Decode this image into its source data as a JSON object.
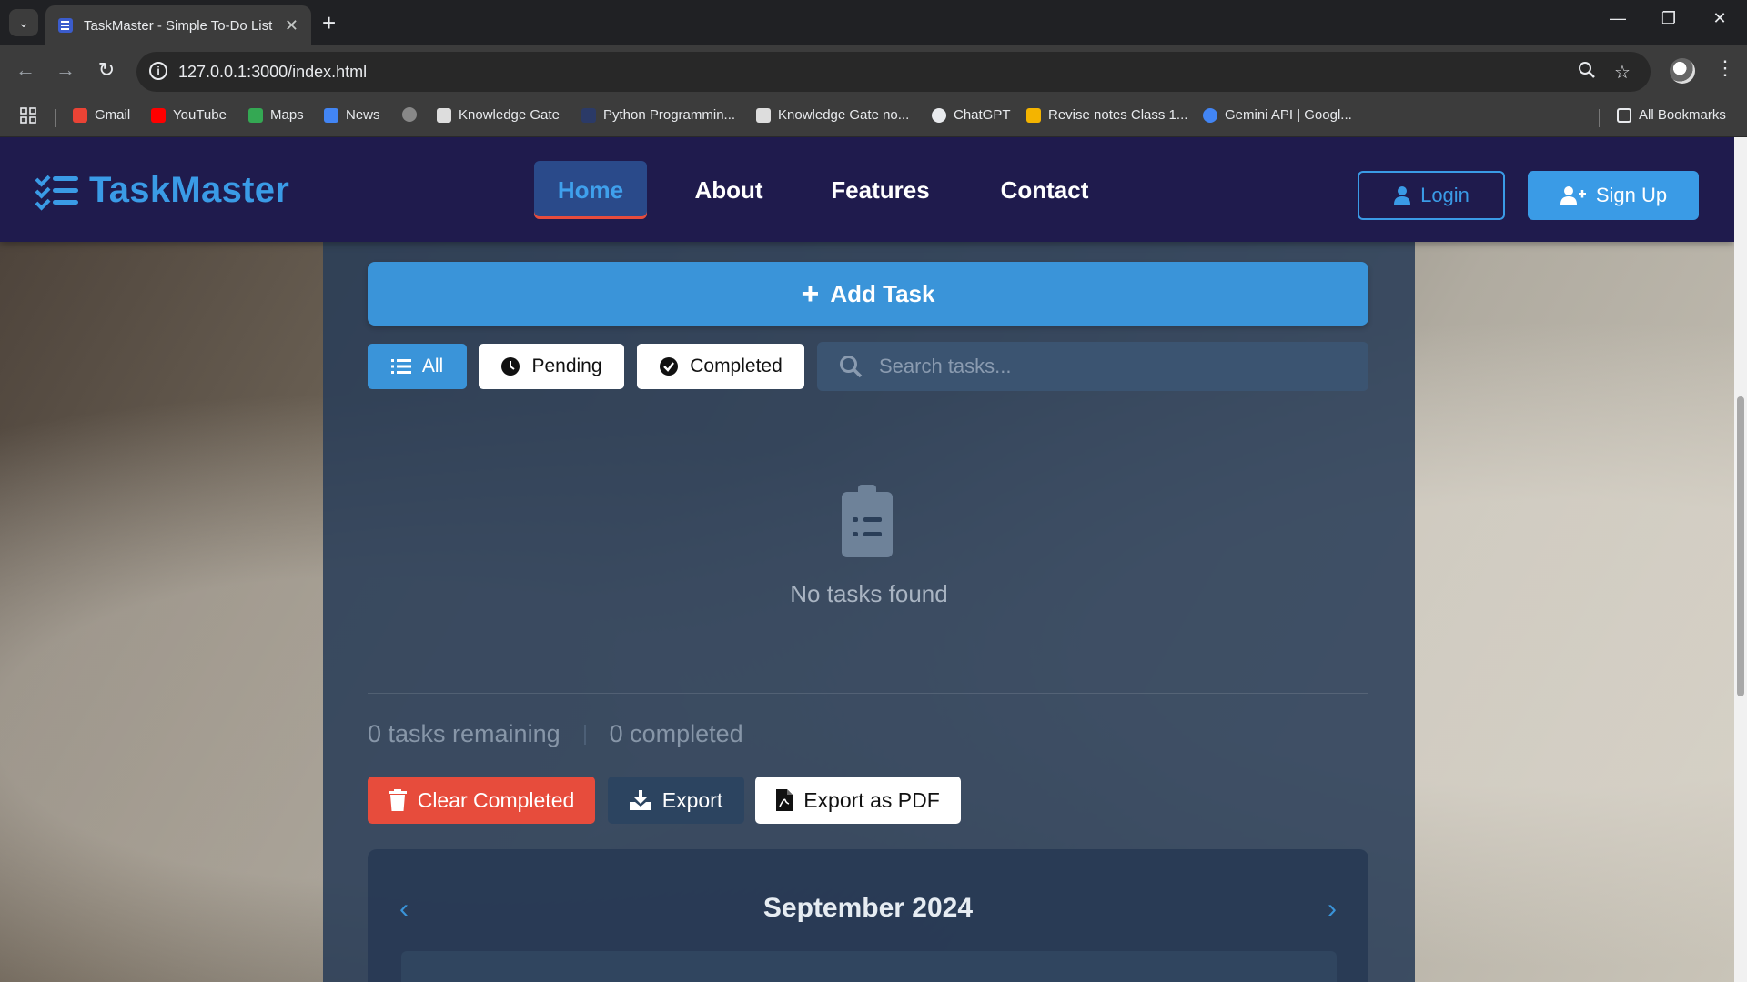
{
  "browser": {
    "tab_title": "TaskMaster - Simple To-Do List",
    "url": "127.0.0.1:3000/index.html",
    "bookmarks": [
      {
        "label": "Gmail",
        "color": "#ea4335"
      },
      {
        "label": "YouTube",
        "color": "#ff0000"
      },
      {
        "label": "Maps",
        "color": "#34a853"
      },
      {
        "label": "News",
        "color": "#4285f4"
      },
      {
        "label": "Knowledge Gate",
        "color": "#dddddd"
      },
      {
        "label": "Python Programmin...",
        "color": "#2b3a67"
      },
      {
        "label": "Knowledge Gate no...",
        "color": "#dddddd"
      },
      {
        "label": "ChatGPT",
        "color": "#e8eaed"
      },
      {
        "label": "Revise notes Class 1...",
        "color": "#f4b400"
      },
      {
        "label": "Gemini API | Googl...",
        "color": "#4285f4"
      }
    ],
    "all_bookmarks": "All Bookmarks"
  },
  "app": {
    "brand": "TaskMaster",
    "nav": {
      "home": "Home",
      "about": "About",
      "features": "Features",
      "contact": "Contact"
    },
    "login": "Login",
    "signup": "Sign Up",
    "add_task": "Add Task",
    "filters": {
      "all": "All",
      "pending": "Pending",
      "completed": "Completed"
    },
    "search_placeholder": "Search tasks...",
    "empty_message": "No tasks found",
    "stats": {
      "remaining": "0 tasks remaining",
      "completed": "0 completed"
    },
    "actions": {
      "clear": "Clear Completed",
      "export": "Export",
      "pdf": "Export as PDF"
    },
    "calendar": {
      "month": "September 2024"
    }
  },
  "colors": {
    "accent": "#3a94d9",
    "navbar": "#1f1b4d",
    "danger": "#e74c3c"
  }
}
